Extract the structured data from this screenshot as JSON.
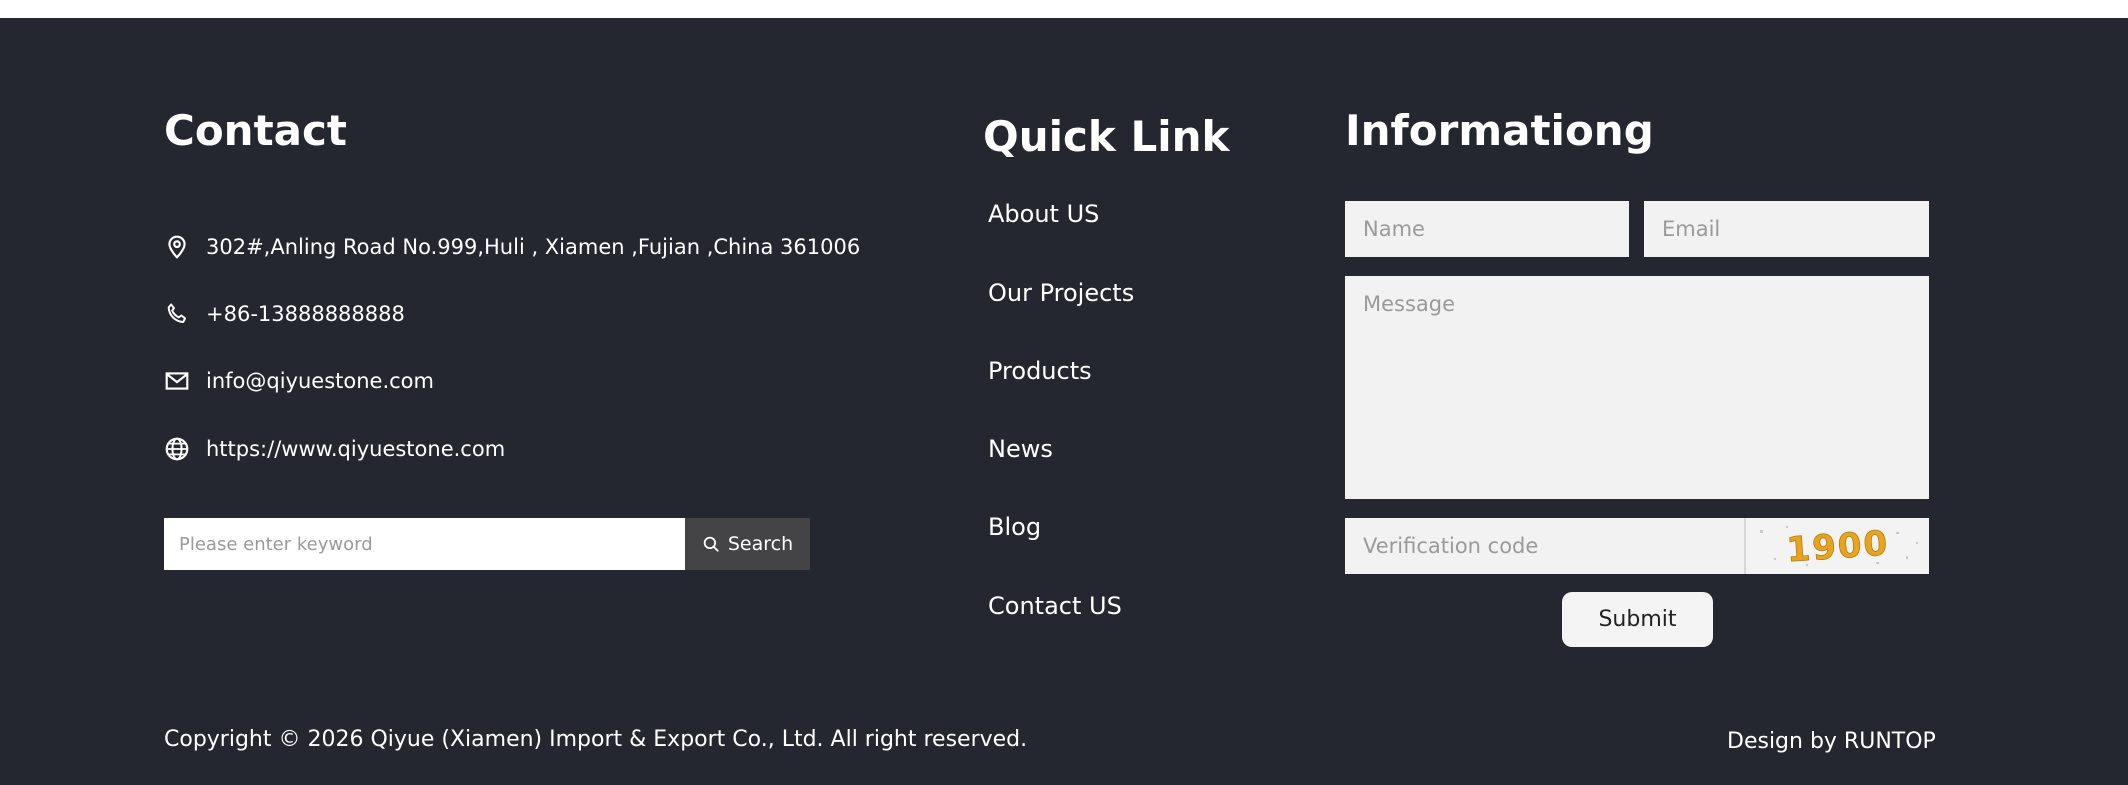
{
  "contact": {
    "heading": "Contact",
    "address": "302#,Anling Road No.999,Huli , Xiamen ,Fujian ,China 361006",
    "phone": "+86-13888888888",
    "email": "info@qiyuestone.com",
    "website": "https://www.qiyuestone.com",
    "search_placeholder": "Please enter keyword",
    "search_label": "Search"
  },
  "quick_link": {
    "heading": "Quick Link",
    "items": [
      "About US",
      "Our Projects",
      "Products",
      "News",
      "Blog",
      "Contact US"
    ]
  },
  "information": {
    "heading": "Informationg",
    "name_placeholder": "Name",
    "email_placeholder": "Email",
    "message_placeholder": "Message",
    "verification_placeholder": "Verification code",
    "captcha_text": "1900",
    "submit_label": "Submit"
  },
  "bottom": {
    "copyright": "Copyright © 2026 Qiyue (Xiamen) Import & Export Co., Ltd. All right reserved.",
    "design_credit": "Design by RUNTOP"
  },
  "colors": {
    "footer_background": "#242730",
    "search_button": "#444446",
    "field_background": "#f2f2f2",
    "captcha_digits": "#e8a41f"
  },
  "icons": [
    "location-pin-icon",
    "phone-icon",
    "mail-icon",
    "globe-icon",
    "search-icon"
  ]
}
